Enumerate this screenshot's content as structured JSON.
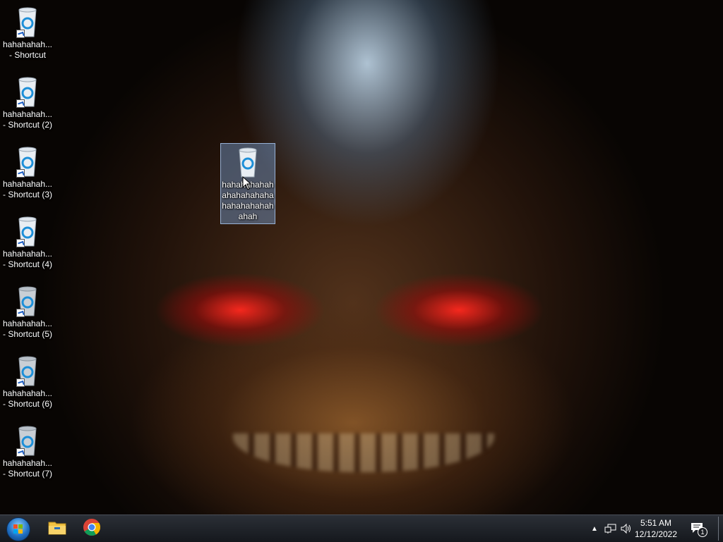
{
  "desktop": {
    "icons": [
      {
        "label": "hahahahah... - Shortcut",
        "shortcut": true
      },
      {
        "label": "hahahahah... - Shortcut (2)",
        "shortcut": true
      },
      {
        "label": "hahahahah... - Shortcut (3)",
        "shortcut": true
      },
      {
        "label": "hahahahah... - Shortcut (4)",
        "shortcut": true
      },
      {
        "label": "hahahahah... - Shortcut (5)",
        "shortcut": true
      },
      {
        "label": "hahahahah... - Shortcut (6)",
        "shortcut": true
      },
      {
        "label": "hahahahah... - Shortcut (7)",
        "shortcut": true
      }
    ],
    "selected_icon": {
      "label": "hahahahahahahahahahahahahahahahahahah",
      "selected": true
    }
  },
  "taskbar": {
    "start_icon": "windows-start-orb-icon",
    "pinned": [
      {
        "name": "file-explorer-icon"
      },
      {
        "name": "chrome-icon"
      }
    ],
    "tray": {
      "overflow_icon": "chevron-up-icon",
      "network_icon": "network-icon",
      "volume_icon": "volume-icon",
      "time": "5:51 AM",
      "date": "12/12/2022",
      "notifications_badge": "1"
    }
  },
  "colors": {
    "taskbar": "#1c1f24",
    "selection": "#7aa0d2",
    "recycle_blue": "#1d8fd8"
  }
}
